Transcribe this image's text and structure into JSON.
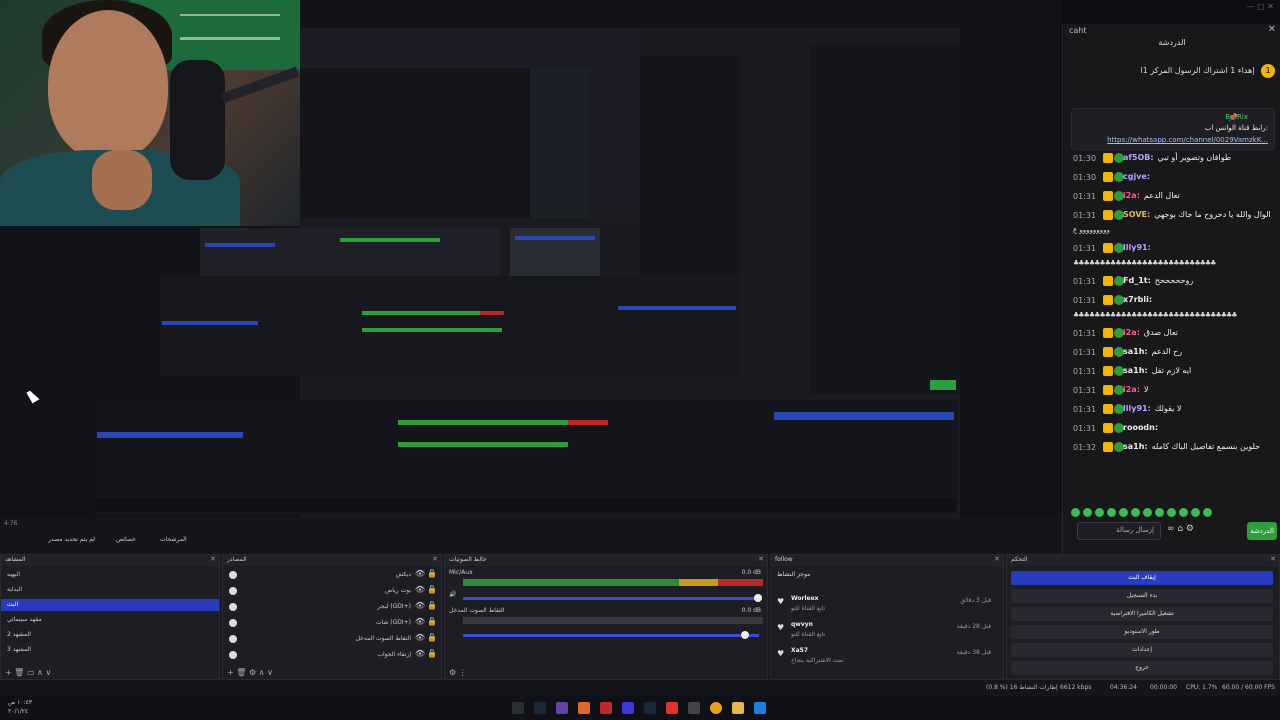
{
  "chat": {
    "title": "caht",
    "close": "✕",
    "header": "الدردشة",
    "pinned_announcement": {
      "badge": "1",
      "text": "إهداء 1 اشتراك الرسول المركز 1ا"
    },
    "pinned_message": {
      "username": "BotRix",
      "text": "رابط قناة الواتس اب:",
      "link": "https://whatsapp.com/channel/0029VamzkK..."
    },
    "messages": [
      {
        "time": "01:30",
        "user": "af5OB:",
        "user_color": "#b1a3ff",
        "text": "طوافان وتصوير أو تبي"
      },
      {
        "time": "01:30",
        "user": "cgjve:",
        "user_color": "#b1a3ff",
        "text": ""
      },
      {
        "time": "01:31",
        "user": "i2a:",
        "user_color": "#ff5b8b",
        "text": "تعال الدعم"
      },
      {
        "time": "01:31",
        "user": "SOVE:",
        "user_color": "#e7b85a",
        "text": "الوال والله يا دحروح ما جاك بوجهي"
      },
      {
        "time": "",
        "user": "",
        "user_color": "#ffffff",
        "text": "ووووووووو ع"
      },
      {
        "time": "01:31",
        "user": "llly91:",
        "user_color": "#b1a3ff",
        "text": ""
      },
      {
        "time": "",
        "user": "",
        "user_color": "#ffffff",
        "text": "♣♣♣♣♣♣♣♣♣♣♣♣♣♣♣♣♣♣♣♣♣♣♣♣♣♣♣"
      },
      {
        "time": "01:31",
        "user": "Fd_1t:",
        "user_color": "#eeeeee",
        "text": "روحححححح"
      },
      {
        "time": "01:31",
        "user": "x7rbli:",
        "user_color": "#eeeeee",
        "text": ""
      },
      {
        "time": "",
        "user": "",
        "user_color": "#ffffff",
        "text": "♣♣♣♣♣♣♣♣♣♣♣♣♣♣♣♣♣♣♣♣♣♣♣♣♣♣♣♣♣♣♣"
      },
      {
        "time": "01:31",
        "user": "i2a:",
        "user_color": "#ff5b8b",
        "text": "تعال صدق"
      },
      {
        "time": "01:31",
        "user": "sa1h:",
        "user_color": "#eeeeee",
        "text": "رح الدعم"
      },
      {
        "time": "01:31",
        "user": "sa1h:",
        "user_color": "#eeeeee",
        "text": "ايه لازم تقل"
      },
      {
        "time": "01:31",
        "user": "i2a:",
        "user_color": "#ff5b8b",
        "text": "لا"
      },
      {
        "time": "01:31",
        "user": "llly91:",
        "user_color": "#b1a3ff",
        "text": "لا يقولك"
      },
      {
        "time": "01:31",
        "user": "rooodn:",
        "user_color": "#eeeeee",
        "text": ""
      },
      {
        "time": "01:32",
        "user": "sa1h:",
        "user_color": "#eeeeee",
        "text": "حلوين بنسمع تفاصيل الباك كامله"
      }
    ],
    "input_placeholder": "إرسال رسالة",
    "send_label": "الدردشة",
    "icons": [
      "mic-icon",
      "infinity-icon",
      "gift-icon",
      "store-icon",
      "settings-icon"
    ]
  },
  "obs": {
    "scene_label": "4:76",
    "toolbar": {
      "btn1": "لم يتم تحديد مصدر",
      "btn2": "خصائص",
      "btn3": "المرشحات"
    },
    "scenes": {
      "title": "المشاهد",
      "items": [
        {
          "name": "البهيه",
          "selected": false
        },
        {
          "name": "البداية",
          "selected": false
        },
        {
          "name": "البث",
          "selected": true
        },
        {
          "name": "مقهد سينمائي",
          "selected": false
        },
        {
          "name": "المشهد 2",
          "selected": false
        },
        {
          "name": "المشهد 3",
          "selected": false
        }
      ]
    },
    "sources": {
      "title": "المصادر",
      "items": [
        {
          "name": "ديكش"
        },
        {
          "name": "بوت رياض"
        },
        {
          "name": "ليجر (GDI+)"
        },
        {
          "name": "شات (GDI+)"
        },
        {
          "name": "التقاط الصوت المدخل"
        },
        {
          "name": "إرتقاء الجواب"
        }
      ]
    },
    "mixer": {
      "title": "خالط الصوتيات",
      "track1": "Mic/Aux",
      "track1_db": "0.0 dB",
      "track2": "التقاط الصوت المدخل",
      "track2_db": "0.0 dB",
      "track1_level": 0.95,
      "track2_level": 0.95
    },
    "follow": {
      "title": "follow",
      "subtitle": "موجز النشاط",
      "items": [
        {
          "name": "Worleex",
          "sub": "تابع القناة للتو",
          "ago": "قبل 3 دقائق"
        },
        {
          "name": "qwvyn",
          "sub": "تابع القناة للتو",
          "ago": "قبل 28 دقيقة"
        },
        {
          "name": "Xa57",
          "sub": "تمت الاشتراكية بنجاح",
          "ago": "قبل 38 دقيقة"
        }
      ]
    },
    "controls": {
      "title": "التحكم",
      "buttons": [
        {
          "label": "إيقاف البث",
          "primary": true
        },
        {
          "label": "بدء التسجيل",
          "primary": false
        },
        {
          "label": "تشغيل الكاميرا الافتراضية",
          "primary": false
        },
        {
          "label": "طور الاستوديو",
          "primary": false
        },
        {
          "label": "إعدادات",
          "primary": false
        },
        {
          "label": "خروج",
          "primary": false
        }
      ]
    },
    "status": {
      "dropped": "(0.8 %) إطارات النشاط 16",
      "kbps": "6612 kbps",
      "live_time": "04:36:24",
      "rec_time": "00:00:00",
      "cpu": "CPU: 1.7%",
      "fps": "60.00 / 60.00 FPS"
    }
  },
  "taskbar": {
    "clock_time": "١٠:٤٣ ص",
    "clock_date": "٢٠/١/٢٤"
  },
  "colors": {
    "accent_blue": "#283dbd",
    "green": "#2e9d3e",
    "chat_bg": "#18181b"
  }
}
